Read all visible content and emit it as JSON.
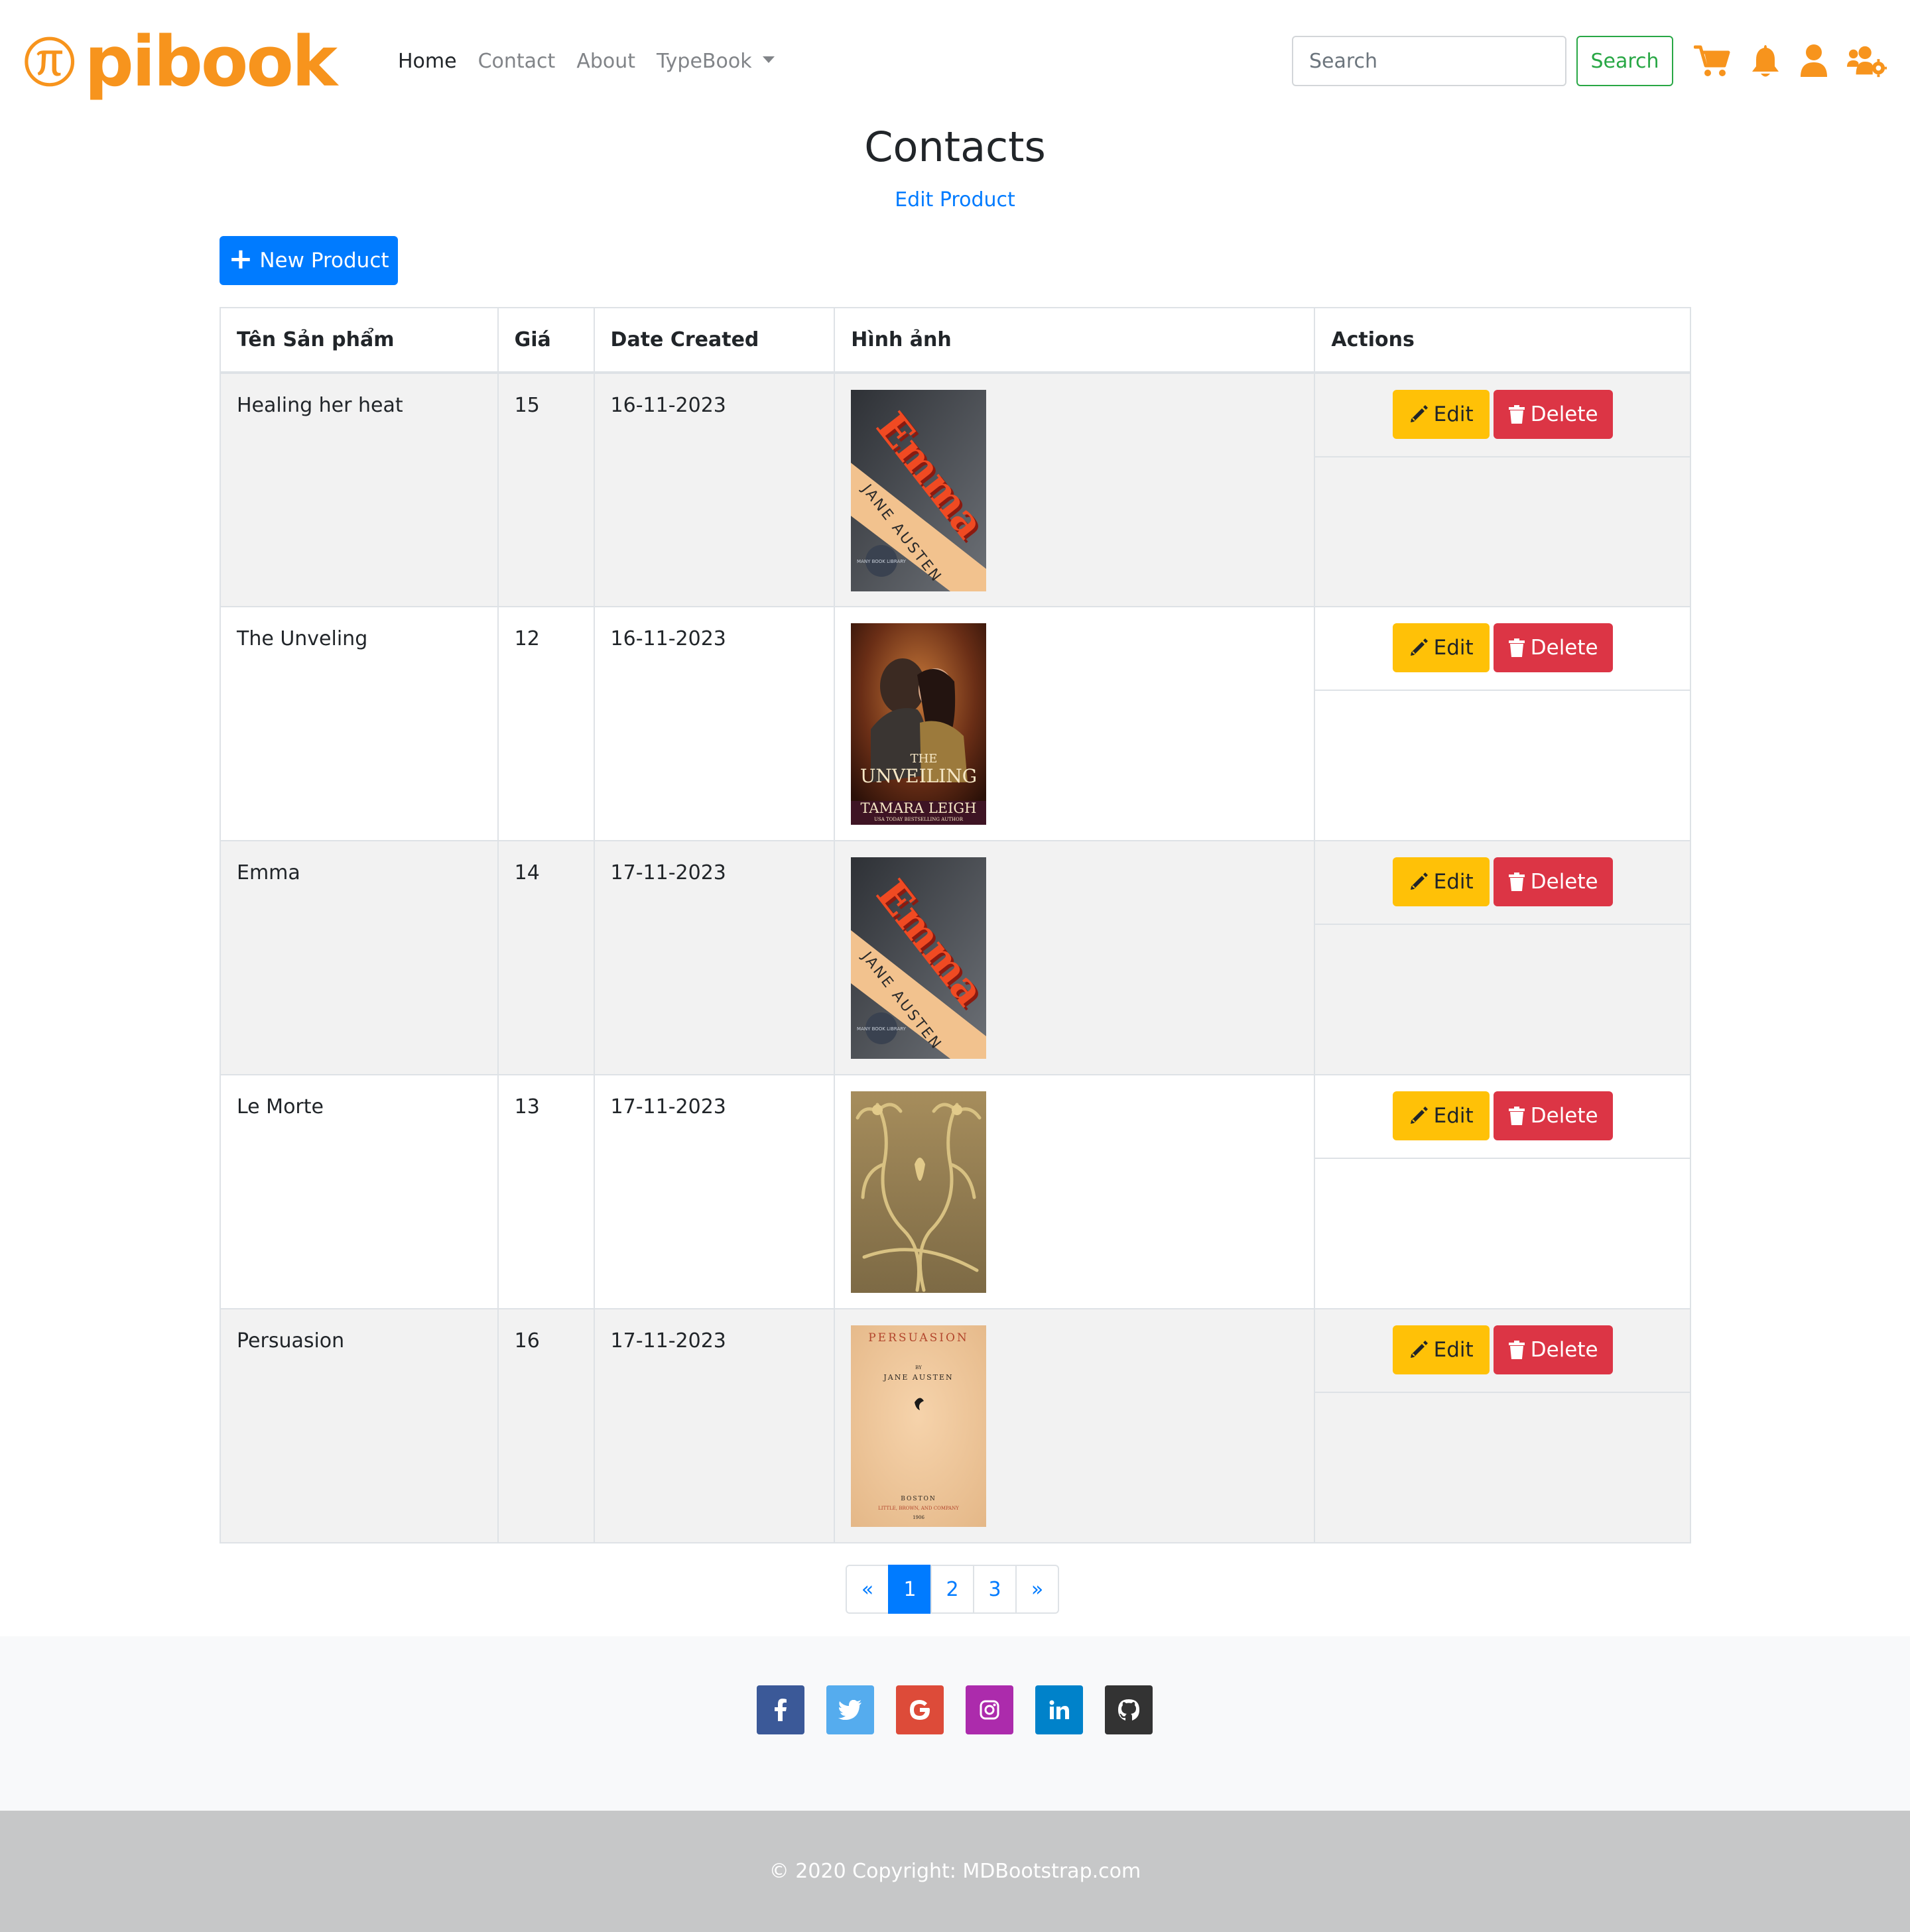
{
  "brand": {
    "name": "pibook",
    "color": "#f7941d"
  },
  "nav": {
    "links": [
      {
        "label": "Home",
        "active": true
      },
      {
        "label": "Contact"
      },
      {
        "label": "About"
      },
      {
        "label": "TypeBook"
      }
    ],
    "search_placeholder": "Search",
    "search_button": "Search",
    "icons": [
      "cart-icon",
      "bell-icon",
      "user-icon",
      "users-cog-icon"
    ]
  },
  "header": {
    "title": "Contacts",
    "subtitle_link": "Edit Product",
    "new_button": "New Product"
  },
  "table": {
    "columns": [
      "Tên Sản phẩm",
      "Giá",
      "Date Created",
      "Hình ảnh",
      "Actions"
    ],
    "edit_label": "Edit",
    "delete_label": "Delete",
    "rows": [
      {
        "name": "Healing her heat",
        "price": "15",
        "date": "16-11-2023",
        "cover": "Emma"
      },
      {
        "name": "The Unveling",
        "price": "12",
        "date": "16-11-2023",
        "cover": "The Unveiling"
      },
      {
        "name": "Emma",
        "price": "14",
        "date": "17-11-2023",
        "cover": "Emma"
      },
      {
        "name": "Le Morte",
        "price": "13",
        "date": "17-11-2023",
        "cover": "ornament"
      },
      {
        "name": "Persuasion",
        "price": "16",
        "date": "17-11-2023",
        "cover": "Persuasion"
      }
    ]
  },
  "covers": {
    "emma_title": "Emma",
    "emma_author": "JANE AUSTEN",
    "emma_badge": "MANY BOOK LIBRARY",
    "unveiling_the": "THE",
    "unveiling_title": "UNVEILING",
    "unveiling_author": "TAMARA LEIGH",
    "unveiling_tagline": "USA TODAY BESTSELLING AUTHOR",
    "persuasion_title": "PERSUASION",
    "persuasion_by": "BY",
    "persuasion_author": "JANE AUSTEN",
    "persuasion_city": "BOSTON",
    "persuasion_publisher": "LITTLE, BROWN, AND COMPANY",
    "persuasion_year": "1906"
  },
  "pagination": {
    "prev": "«",
    "pages": [
      "1",
      "2",
      "3"
    ],
    "active": "1",
    "next": "»"
  },
  "footer": {
    "social": [
      {
        "name": "facebook",
        "color": "#3b5998"
      },
      {
        "name": "twitter",
        "color": "#55acee"
      },
      {
        "name": "google",
        "color": "#dd4b39"
      },
      {
        "name": "instagram",
        "color": "#ac2bac"
      },
      {
        "name": "linkedin",
        "color": "#0082ca"
      },
      {
        "name": "github",
        "color": "#333333"
      }
    ],
    "copyright": "© 2020 Copyright: MDBootstrap.com"
  },
  "colors": {
    "primary": "#007bff",
    "success": "#28a745",
    "warning": "#ffc107",
    "danger": "#dc3545",
    "stripe": "#f2f2f2",
    "footer_bg": "#f8f9fa",
    "copyright_bg": "#c6c7c8"
  }
}
